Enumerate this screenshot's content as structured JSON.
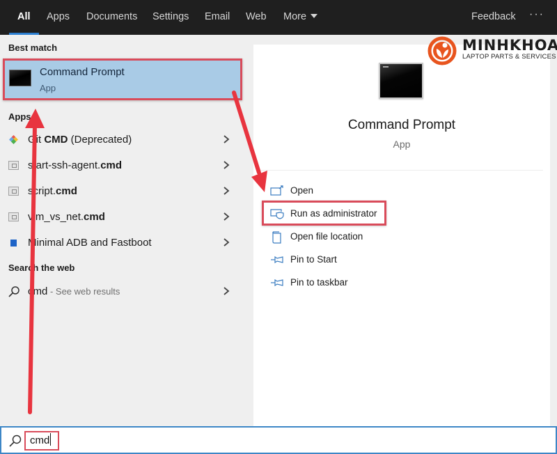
{
  "nav": {
    "tabs": [
      {
        "label": "All",
        "active": true
      },
      {
        "label": "Apps"
      },
      {
        "label": "Documents"
      },
      {
        "label": "Settings"
      },
      {
        "label": "Email"
      },
      {
        "label": "Web"
      },
      {
        "label": "More"
      }
    ],
    "feedback": "Feedback",
    "more_options": "···"
  },
  "left": {
    "best_match_heading": "Best match",
    "best_match": {
      "title": "Command Prompt",
      "subtitle": "App",
      "icon": "command-prompt-icon"
    },
    "apps_heading": "Apps",
    "apps": [
      {
        "prefix": "Git ",
        "bold": "CMD",
        "suffix": " (Deprecated)",
        "icon": "git-icon"
      },
      {
        "prefix": "start-ssh-agent.",
        "bold": "cmd",
        "suffix": "",
        "icon": "cmd-file-icon"
      },
      {
        "prefix": "script.",
        "bold": "cmd",
        "suffix": "",
        "icon": "cmd-file-icon"
      },
      {
        "prefix": "vim_vs_net.",
        "bold": "cmd",
        "suffix": "",
        "icon": "cmd-file-icon"
      },
      {
        "prefix": "Minimal ADB and Fastboot",
        "bold": "",
        "suffix": "",
        "icon": "adb-icon"
      }
    ],
    "web_heading": "Search the web",
    "web_result": {
      "query": "cmd",
      "suffix": " - See web results"
    }
  },
  "right": {
    "title": "Command Prompt",
    "subtitle": "App",
    "actions": [
      {
        "label": "Open",
        "icon": "open-icon"
      },
      {
        "label": "Run as administrator",
        "icon": "shield-icon"
      },
      {
        "label": "Open file location",
        "icon": "file-location-icon"
      },
      {
        "label": "Pin to Start",
        "icon": "pin-icon"
      },
      {
        "label": "Pin to taskbar",
        "icon": "pin-icon"
      }
    ]
  },
  "logo": {
    "name": "MINHKHOA",
    "tagline": "LAPTOP PARTS & SERVICES",
    "color": "#e8541e"
  },
  "search": {
    "value": "cmd"
  },
  "colors": {
    "accent": "#2c7fd0",
    "highlight": "#a9cbe6",
    "annotation": "#e8343f",
    "topbar": "#1f1f1f"
  }
}
